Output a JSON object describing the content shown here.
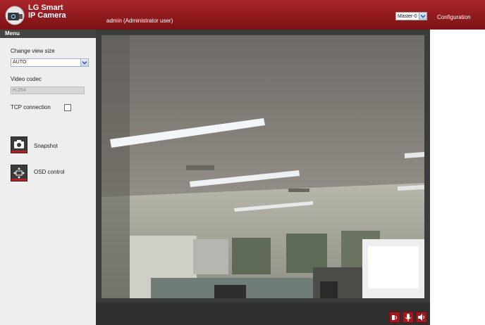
{
  "header": {
    "brand_line1": "LG Smart",
    "brand_line2": "IP Camera",
    "user": "admin (Administrator user)",
    "camera_selected": "Master-0",
    "configuration": "Configuration"
  },
  "sidebar": {
    "menu_title": "Menu",
    "change_view_size_label": "Change view size",
    "view_size_selected": "AUTO",
    "video_codec_label": "Video codec",
    "video_codec_value": "H.264",
    "tcp_label": "TCP connection",
    "snapshot_label": "Snapshot",
    "osd_label": "OSD control"
  },
  "controls": {
    "icons": [
      "speaker-icon",
      "microphone-icon",
      "volume-icon"
    ]
  },
  "colors": {
    "header_red": "#a9252a",
    "menu_dark": "#444444",
    "video_border": "#3c3c3c",
    "control_red": "#a01b1f"
  }
}
